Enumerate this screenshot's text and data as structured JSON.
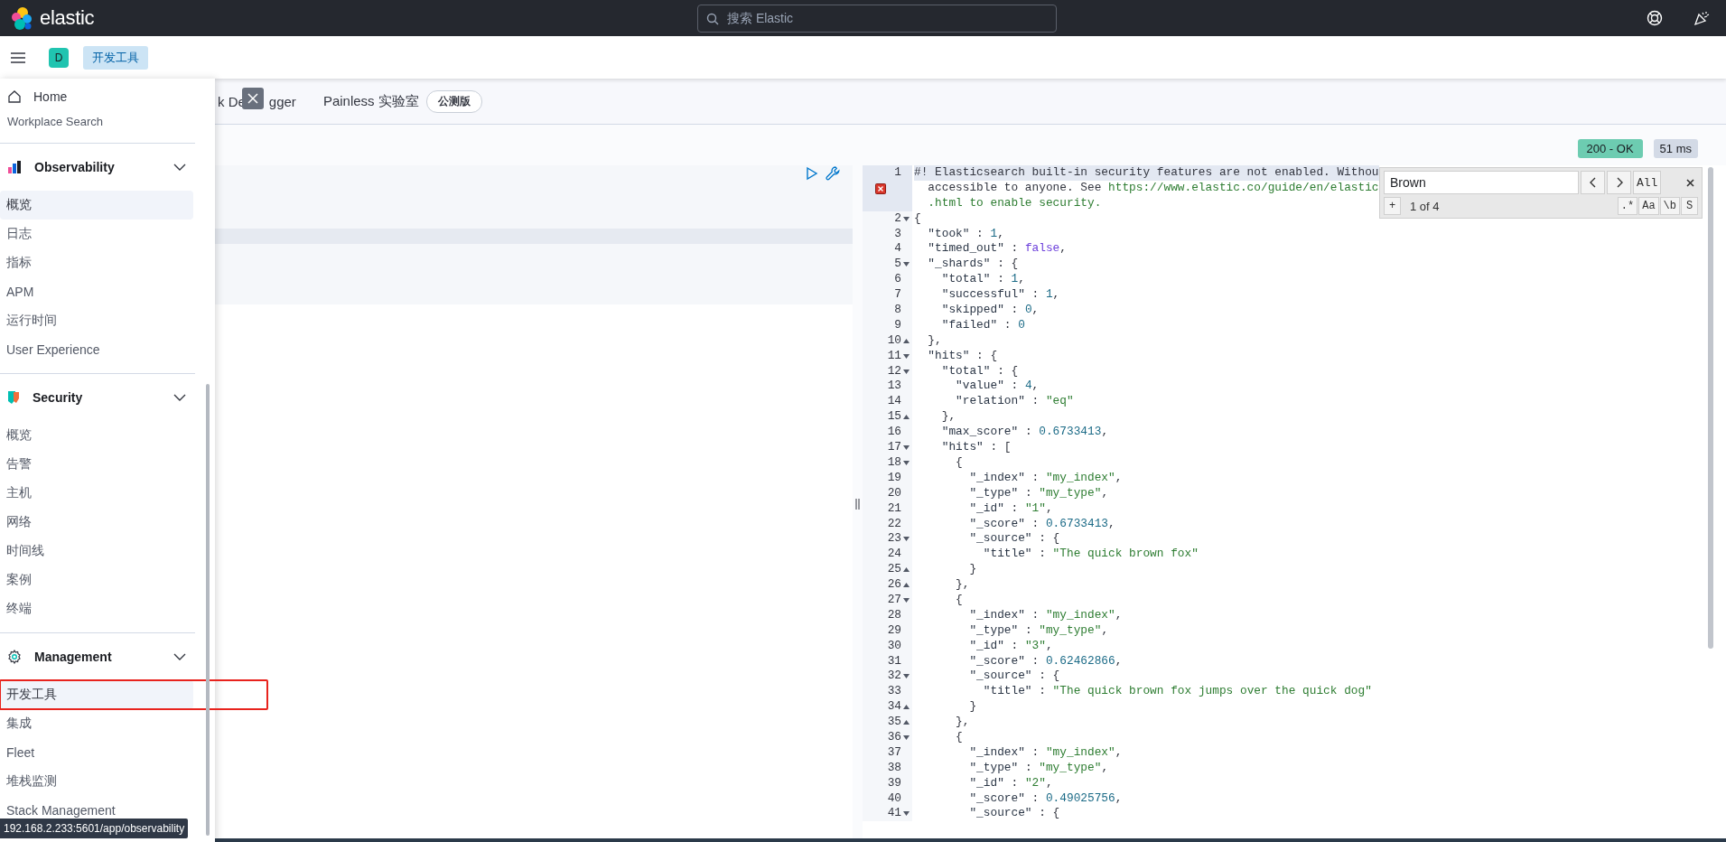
{
  "header": {
    "logo_text": "elastic",
    "search": {
      "placeholder": "搜索 Elastic"
    }
  },
  "subbar": {
    "avatar": "D",
    "breadcrumb": "开发工具"
  },
  "tabs": [
    {
      "label_parts": [
        "k De",
        "gger"
      ]
    },
    {
      "label": "Painless 实验室",
      "badge": "公测版"
    }
  ],
  "nav_flyout": {
    "home": "Home",
    "partial_item": "Workplace Search",
    "sections": [
      {
        "title": "Observability",
        "kind": "observability",
        "expanded": true,
        "items": [
          {
            "label": "概览",
            "selected": true,
            "annotated": false
          },
          {
            "label": "日志",
            "selected": false,
            "annotated": false
          },
          {
            "label": "指标",
            "selected": false,
            "annotated": false
          },
          {
            "label": "APM",
            "selected": false,
            "annotated": false
          },
          {
            "label": "运行时间",
            "selected": false,
            "annotated": false
          },
          {
            "label": "User Experience",
            "selected": false,
            "annotated": false
          }
        ]
      },
      {
        "title": "Security",
        "kind": "security",
        "expanded": true,
        "items": [
          {
            "label": "概览",
            "selected": false,
            "annotated": false
          },
          {
            "label": "告警",
            "selected": false,
            "annotated": false
          },
          {
            "label": "主机",
            "selected": false,
            "annotated": false
          },
          {
            "label": "网络",
            "selected": false,
            "annotated": false
          },
          {
            "label": "时间线",
            "selected": false,
            "annotated": false
          },
          {
            "label": "案例",
            "selected": false,
            "annotated": false
          },
          {
            "label": "终端",
            "selected": false,
            "annotated": false
          }
        ]
      },
      {
        "title": "Management",
        "kind": "management",
        "expanded": true,
        "items": [
          {
            "label": "开发工具",
            "selected": true,
            "annotated": true
          },
          {
            "label": "集成",
            "selected": false,
            "annotated": false
          },
          {
            "label": "Fleet",
            "selected": false,
            "annotated": false
          },
          {
            "label": "堆栈监测",
            "selected": false,
            "annotated": false
          },
          {
            "label": "Stack Management",
            "selected": false,
            "annotated": false
          }
        ]
      }
    ]
  },
  "status": {
    "code": "200 - OK",
    "time": "51 ms"
  },
  "find": {
    "value": "Brown",
    "count": "1 of 4",
    "all": "All",
    "plus": "+",
    "options": [
      ".*",
      "Aa",
      "\\b",
      "S"
    ]
  },
  "output": {
    "lines": [
      {
        "no": "1",
        "error": true,
        "active": true,
        "segs": [
          {
            "kind": "punct",
            "text": "#! Elasticsearch built-in security features are not enabled. Withou"
          }
        ],
        "continuation": [
          [
            {
              "kind": "punct",
              "text": "  accessible to anyone. See "
            },
            {
              "kind": "string",
              "text": "https://www.elastic.co/guide/en/elastic"
            }
          ],
          [
            {
              "kind": "string",
              "text": "  .html to enable security."
            }
          ]
        ]
      },
      {
        "no": "2",
        "fold_start": true,
        "segs": [
          {
            "kind": "punct",
            "text": "{"
          }
        ]
      },
      {
        "no": "3",
        "segs": [
          {
            "kind": "key",
            "text": "  \"took\""
          },
          {
            "kind": "punct",
            "text": " : "
          },
          {
            "kind": "number",
            "text": "1"
          },
          {
            "kind": "punct",
            "text": ","
          }
        ]
      },
      {
        "no": "4",
        "segs": [
          {
            "kind": "key",
            "text": "  \"timed_out\""
          },
          {
            "kind": "punct",
            "text": " : "
          },
          {
            "kind": "bool",
            "text": "false"
          },
          {
            "kind": "punct",
            "text": ","
          }
        ]
      },
      {
        "no": "5",
        "fold_start": true,
        "segs": [
          {
            "kind": "key",
            "text": "  \"_shards\""
          },
          {
            "kind": "punct",
            "text": " : {"
          }
        ]
      },
      {
        "no": "6",
        "segs": [
          {
            "kind": "key",
            "text": "    \"total\""
          },
          {
            "kind": "punct",
            "text": " : "
          },
          {
            "kind": "number",
            "text": "1"
          },
          {
            "kind": "punct",
            "text": ","
          }
        ]
      },
      {
        "no": "7",
        "segs": [
          {
            "kind": "key",
            "text": "    \"successful\""
          },
          {
            "kind": "punct",
            "text": " : "
          },
          {
            "kind": "number",
            "text": "1"
          },
          {
            "kind": "punct",
            "text": ","
          }
        ]
      },
      {
        "no": "8",
        "segs": [
          {
            "kind": "key",
            "text": "    \"skipped\""
          },
          {
            "kind": "punct",
            "text": " : "
          },
          {
            "kind": "number",
            "text": "0"
          },
          {
            "kind": "punct",
            "text": ","
          }
        ]
      },
      {
        "no": "9",
        "segs": [
          {
            "kind": "key",
            "text": "    \"failed\""
          },
          {
            "kind": "punct",
            "text": " : "
          },
          {
            "kind": "number",
            "text": "0"
          }
        ]
      },
      {
        "no": "10",
        "fold_end": true,
        "segs": [
          {
            "kind": "punct",
            "text": "  },"
          }
        ]
      },
      {
        "no": "11",
        "fold_start": true,
        "segs": [
          {
            "kind": "key",
            "text": "  \"hits\""
          },
          {
            "kind": "punct",
            "text": " : {"
          }
        ]
      },
      {
        "no": "12",
        "fold_start": true,
        "segs": [
          {
            "kind": "key",
            "text": "    \"total\""
          },
          {
            "kind": "punct",
            "text": " : {"
          }
        ]
      },
      {
        "no": "13",
        "segs": [
          {
            "kind": "key",
            "text": "      \"value\""
          },
          {
            "kind": "punct",
            "text": " : "
          },
          {
            "kind": "number",
            "text": "4"
          },
          {
            "kind": "punct",
            "text": ","
          }
        ]
      },
      {
        "no": "14",
        "segs": [
          {
            "kind": "key",
            "text": "      \"relation\""
          },
          {
            "kind": "punct",
            "text": " : "
          },
          {
            "kind": "string",
            "text": "\"eq\""
          }
        ]
      },
      {
        "no": "15",
        "fold_end": true,
        "segs": [
          {
            "kind": "punct",
            "text": "    },"
          }
        ]
      },
      {
        "no": "16",
        "segs": [
          {
            "kind": "key",
            "text": "    \"max_score\""
          },
          {
            "kind": "punct",
            "text": " : "
          },
          {
            "kind": "number",
            "text": "0.6733413"
          },
          {
            "kind": "punct",
            "text": ","
          }
        ]
      },
      {
        "no": "17",
        "fold_start": true,
        "segs": [
          {
            "kind": "key",
            "text": "    \"hits\""
          },
          {
            "kind": "punct",
            "text": " : ["
          }
        ]
      },
      {
        "no": "18",
        "fold_start": true,
        "segs": [
          {
            "kind": "punct",
            "text": "      {"
          }
        ]
      },
      {
        "no": "19",
        "segs": [
          {
            "kind": "key",
            "text": "        \"_index\""
          },
          {
            "kind": "punct",
            "text": " : "
          },
          {
            "kind": "string",
            "text": "\"my_index\""
          },
          {
            "kind": "punct",
            "text": ","
          }
        ]
      },
      {
        "no": "20",
        "segs": [
          {
            "kind": "key",
            "text": "        \"_type\""
          },
          {
            "kind": "punct",
            "text": " : "
          },
          {
            "kind": "string",
            "text": "\"my_type\""
          },
          {
            "kind": "punct",
            "text": ","
          }
        ]
      },
      {
        "no": "21",
        "segs": [
          {
            "kind": "key",
            "text": "        \"_id\""
          },
          {
            "kind": "punct",
            "text": " : "
          },
          {
            "kind": "string",
            "text": "\"1\""
          },
          {
            "kind": "punct",
            "text": ","
          }
        ]
      },
      {
        "no": "22",
        "segs": [
          {
            "kind": "key",
            "text": "        \"_score\""
          },
          {
            "kind": "punct",
            "text": " : "
          },
          {
            "kind": "number",
            "text": "0.6733413"
          },
          {
            "kind": "punct",
            "text": ","
          }
        ]
      },
      {
        "no": "23",
        "fold_start": true,
        "segs": [
          {
            "kind": "key",
            "text": "        \"_source\""
          },
          {
            "kind": "punct",
            "text": " : {"
          }
        ]
      },
      {
        "no": "24",
        "segs": [
          {
            "kind": "key",
            "text": "          \"title\""
          },
          {
            "kind": "punct",
            "text": " : "
          },
          {
            "kind": "string",
            "text": "\"The quick brown fox\""
          }
        ]
      },
      {
        "no": "25",
        "fold_end": true,
        "segs": [
          {
            "kind": "punct",
            "text": "        }"
          }
        ]
      },
      {
        "no": "26",
        "fold_end": true,
        "segs": [
          {
            "kind": "punct",
            "text": "      },"
          }
        ]
      },
      {
        "no": "27",
        "fold_start": true,
        "segs": [
          {
            "kind": "punct",
            "text": "      {"
          }
        ]
      },
      {
        "no": "28",
        "segs": [
          {
            "kind": "key",
            "text": "        \"_index\""
          },
          {
            "kind": "punct",
            "text": " : "
          },
          {
            "kind": "string",
            "text": "\"my_index\""
          },
          {
            "kind": "punct",
            "text": ","
          }
        ]
      },
      {
        "no": "29",
        "segs": [
          {
            "kind": "key",
            "text": "        \"_type\""
          },
          {
            "kind": "punct",
            "text": " : "
          },
          {
            "kind": "string",
            "text": "\"my_type\""
          },
          {
            "kind": "punct",
            "text": ","
          }
        ]
      },
      {
        "no": "30",
        "segs": [
          {
            "kind": "key",
            "text": "        \"_id\""
          },
          {
            "kind": "punct",
            "text": " : "
          },
          {
            "kind": "string",
            "text": "\"3\""
          },
          {
            "kind": "punct",
            "text": ","
          }
        ]
      },
      {
        "no": "31",
        "segs": [
          {
            "kind": "key",
            "text": "        \"_score\""
          },
          {
            "kind": "punct",
            "text": " : "
          },
          {
            "kind": "number",
            "text": "0.62462866"
          },
          {
            "kind": "punct",
            "text": ","
          }
        ]
      },
      {
        "no": "32",
        "fold_start": true,
        "segs": [
          {
            "kind": "key",
            "text": "        \"_source\""
          },
          {
            "kind": "punct",
            "text": " : {"
          }
        ]
      },
      {
        "no": "33",
        "segs": [
          {
            "kind": "key",
            "text": "          \"title\""
          },
          {
            "kind": "punct",
            "text": " : "
          },
          {
            "kind": "string",
            "text": "\"The quick brown fox jumps over the quick dog\""
          }
        ]
      },
      {
        "no": "34",
        "fold_end": true,
        "segs": [
          {
            "kind": "punct",
            "text": "        }"
          }
        ]
      },
      {
        "no": "35",
        "fold_end": true,
        "segs": [
          {
            "kind": "punct",
            "text": "      },"
          }
        ]
      },
      {
        "no": "36",
        "fold_start": true,
        "segs": [
          {
            "kind": "punct",
            "text": "      {"
          }
        ]
      },
      {
        "no": "37",
        "segs": [
          {
            "kind": "key",
            "text": "        \"_index\""
          },
          {
            "kind": "punct",
            "text": " : "
          },
          {
            "kind": "string",
            "text": "\"my_index\""
          },
          {
            "kind": "punct",
            "text": ","
          }
        ]
      },
      {
        "no": "38",
        "segs": [
          {
            "kind": "key",
            "text": "        \"_type\""
          },
          {
            "kind": "punct",
            "text": " : "
          },
          {
            "kind": "string",
            "text": "\"my_type\""
          },
          {
            "kind": "punct",
            "text": ","
          }
        ]
      },
      {
        "no": "39",
        "segs": [
          {
            "kind": "key",
            "text": "        \"_id\""
          },
          {
            "kind": "punct",
            "text": " : "
          },
          {
            "kind": "string",
            "text": "\"2\""
          },
          {
            "kind": "punct",
            "text": ","
          }
        ]
      },
      {
        "no": "40",
        "segs": [
          {
            "kind": "key",
            "text": "        \"_score\""
          },
          {
            "kind": "punct",
            "text": " : "
          },
          {
            "kind": "number",
            "text": "0.49025756"
          },
          {
            "kind": "punct",
            "text": ","
          }
        ]
      },
      {
        "no": "41",
        "fold_start": true,
        "segs": [
          {
            "kind": "key",
            "text": "        \"_source\""
          },
          {
            "kind": "punct",
            "text": " : {"
          }
        ]
      }
    ]
  },
  "status_url": "192.168.2.233:5601/app/observability"
}
